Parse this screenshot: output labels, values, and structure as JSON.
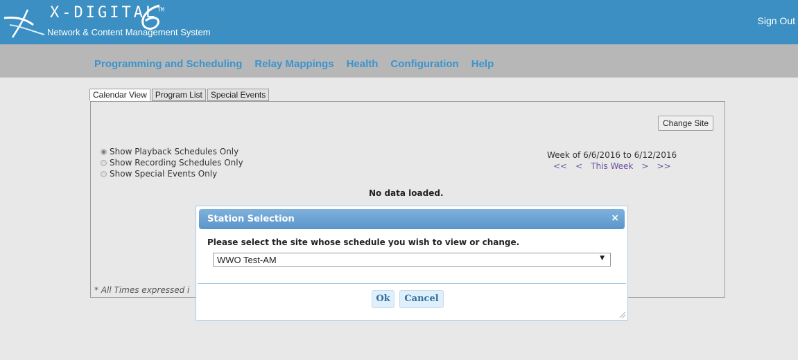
{
  "header": {
    "brand_title": "X-DIGITAL",
    "brand_tm": "TM",
    "brand_subtitle": "Network & Content Management System",
    "sign_out": "Sign Out",
    "colors": {
      "header_bg": "#3b8fc2",
      "nav_bg": "#b7b7b7",
      "nav_link": "#3a94cf"
    }
  },
  "nav": {
    "items": [
      {
        "label": "Programming and Scheduling"
      },
      {
        "label": "Relay Mappings"
      },
      {
        "label": "Health"
      },
      {
        "label": "Configuration"
      },
      {
        "label": "Help"
      }
    ]
  },
  "tabs": [
    {
      "label": "Calendar View",
      "active": true
    },
    {
      "label": "Program List",
      "active": false
    },
    {
      "label": "Special Events",
      "active": false
    }
  ],
  "calendar": {
    "change_site": "Change Site",
    "schedule_options": [
      {
        "label": "Show Playback Schedules Only",
        "checked": true
      },
      {
        "label": "Show Recording Schedules Only",
        "checked": false
      },
      {
        "label": "Show Special Events Only",
        "checked": false
      }
    ],
    "week_label": "Week of 6/6/2016 to 6/12/2016",
    "week_nav": {
      "first": "<<",
      "prev": "<",
      "this_week": "This Week",
      "next": ">",
      "last": ">>"
    },
    "no_data": "No data loaded.",
    "footnote": "* All Times expressed i"
  },
  "dialog": {
    "title": "Station Selection",
    "close": "×",
    "prompt": "Please select the site whose schedule you wish to view or change.",
    "selected_site": "WWO Test-AM",
    "ok": "Ok",
    "cancel": "Cancel"
  }
}
